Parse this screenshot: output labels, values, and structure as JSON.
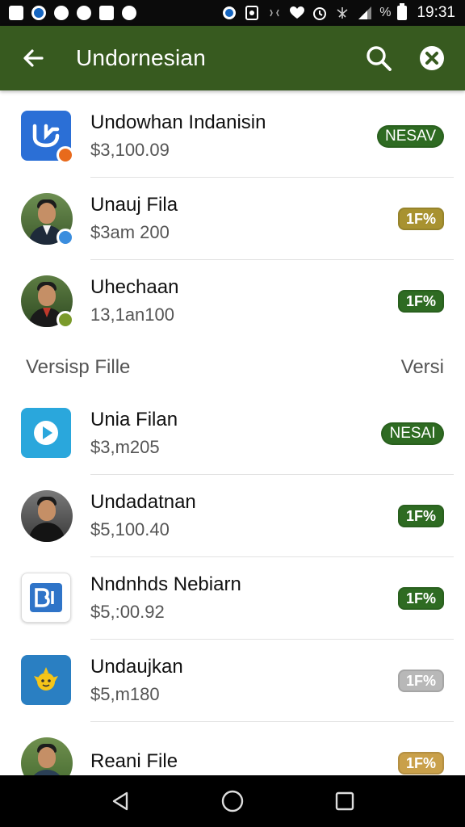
{
  "status_bar": {
    "time": "19:31",
    "battery_label": "%"
  },
  "app_bar": {
    "title": "Undornesian",
    "color": "#375a1f"
  },
  "items_top": [
    {
      "name": "Undowhan Indanisin",
      "price": "$3,100.09",
      "tag": "NESAV",
      "tag_color": "#2e6b22",
      "icon": "app-logo-icon",
      "tag_style": "wide"
    },
    {
      "name": "Unauj Fila",
      "price": "$3am 200",
      "tag": "1F%",
      "tag_color": "#a89230",
      "icon": "profile-photo",
      "tag_style": "small"
    },
    {
      "name": "Uhechaan",
      "price": "13,1an100",
      "tag": "1F%",
      "tag_color": "#2e6b22",
      "icon": "profile-photo",
      "tag_style": "small"
    }
  ],
  "section": {
    "title": "Versisp Fille",
    "right": "Versi"
  },
  "items_bottom": [
    {
      "name": "Unia Filan",
      "price": "$3,m205",
      "tag": "NESAI",
      "tag_color": "#2e6b22",
      "icon": "play-app-icon",
      "tag_style": "wide"
    },
    {
      "name": "Undadatnan",
      "price": "$5,100.40",
      "tag": "1F%",
      "tag_color": "#2e6b22",
      "icon": "profile-photo",
      "tag_style": "small"
    },
    {
      "name": "Nndnhds Nebiarn",
      "price": "$5,:00.92",
      "tag": "1F%",
      "tag_color": "#2e6b22",
      "icon": "b-app-icon",
      "tag_style": "small"
    },
    {
      "name": "Undaujkan",
      "price": "$5,m180",
      "tag": "1F%",
      "tag_color": "#b8b8b8",
      "icon": "sun-app-icon",
      "tag_style": "small"
    },
    {
      "name": "Reani File",
      "price": "",
      "tag": "1F%",
      "tag_color": "#c9a04a",
      "icon": "profile-photo",
      "tag_style": "small"
    }
  ]
}
